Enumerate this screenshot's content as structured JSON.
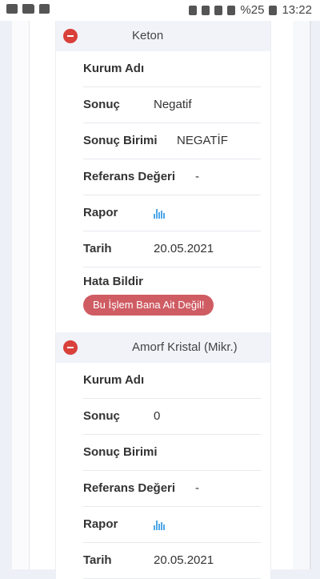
{
  "status_bar": {
    "battery_percent": "%25",
    "time": "13:22"
  },
  "cards": [
    {
      "title": "Keton",
      "rows": {
        "institution_label": "Kurum Adı",
        "institution_value": "",
        "result_label": "Sonuç",
        "result_value": "Negatif",
        "unit_label": "Sonuç Birimi",
        "unit_value": "NEGATİF",
        "reference_label": "Referans Değeri",
        "reference_value": "-",
        "report_label": "Rapor",
        "date_label": "Tarih",
        "date_value": "20.05.2021"
      },
      "error_label": "Hata Bildir",
      "error_button": "Bu İşlem Bana Ait Değil!"
    },
    {
      "title": "Amorf Kristal (Mikr.)",
      "rows": {
        "institution_label": "Kurum Adı",
        "institution_value": "",
        "result_label": "Sonuç",
        "result_value": "0",
        "unit_label": "Sonuç Birimi",
        "unit_value": "",
        "reference_label": "Referans Değeri",
        "reference_value": "-",
        "report_label": "Rapor",
        "date_label": "Tarih",
        "date_value": "20.05.2021"
      }
    }
  ],
  "icons": {
    "collapse": "minus-circle-icon",
    "report": "bar-chart-icon"
  },
  "colors": {
    "accent_red": "#d9403a",
    "button_red": "#cf5c63",
    "chart_blue": "#4fa8e8"
  }
}
